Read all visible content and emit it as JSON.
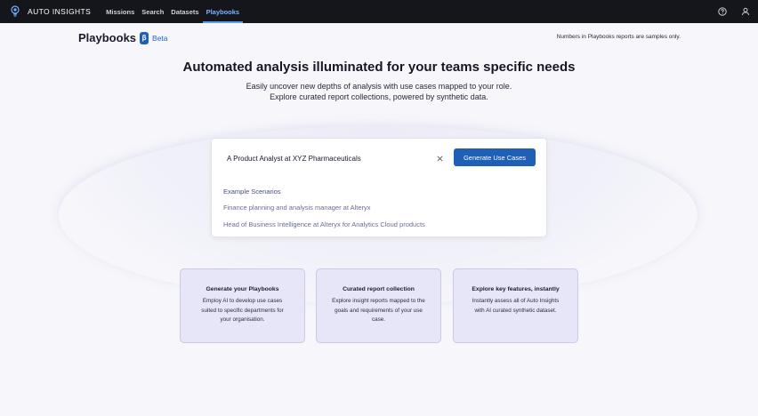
{
  "nav": {
    "brand": "AUTO INSIGHTS",
    "items": [
      {
        "label": "Missions",
        "active": false
      },
      {
        "label": "Search",
        "active": false
      },
      {
        "label": "Datasets",
        "active": false
      },
      {
        "label": "Playbooks",
        "active": true
      }
    ],
    "right_icons": [
      "help-icon",
      "user-icon"
    ],
    "brand_icon": "lightbulb-icon"
  },
  "header": {
    "title": "Playbooks",
    "badge_symbol": "β",
    "badge_text": "Beta",
    "note": "Numbers in Playbooks reports are samples only."
  },
  "hero": {
    "title": "Automated analysis illuminated for your teams specific needs",
    "subtitle_line1": "Easily uncover new depths of analysis with use cases mapped to your role.",
    "subtitle_line2": "Explore curated report collections, powered by synthetic data."
  },
  "search": {
    "value": "A Product Analyst at XYZ Pharmaceuticals",
    "button_label": "Generate Use Cases",
    "examples_heading": "Example Scenarios",
    "examples": [
      "Finance planning and analysis manager at Alteryx",
      "Head of Business Intelligence at Alteryx for Analytics Cloud products"
    ]
  },
  "features": [
    {
      "title": "Generate your Playbooks",
      "desc": "Employ AI to develop use cases suited to specific departments for your organisation."
    },
    {
      "title": "Curated report collection",
      "desc": "Explore insight reports mapped to the goals and requirements of your use case."
    },
    {
      "title": "Explore key features, instantly",
      "desc": "Instantly assess all of Auto Insights with AI curated synthetic dataset."
    }
  ],
  "colors": {
    "nav_bg": "#15151c",
    "accent": "#1f5fb5",
    "active_nav": "#7ab3ff",
    "card_bg": "#e6e6f8"
  }
}
